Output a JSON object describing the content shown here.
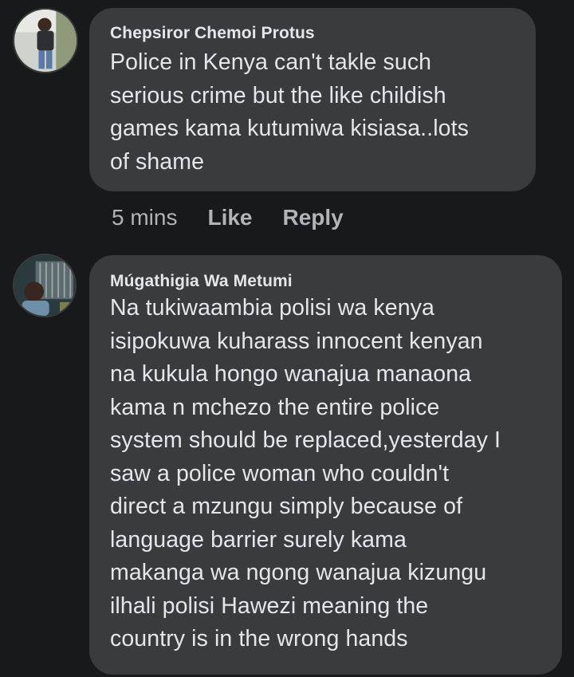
{
  "comments": [
    {
      "author": "Chepsiror Chemoi Protus",
      "text": "Police in Kenya can't takle such\nserious crime but the like childish\ngames kama kutumiwa kisiasa..lots\nof shame",
      "time": "5 mins",
      "like_label": "Like",
      "reply_label": "Reply"
    },
    {
      "author": "Múgathigia Wa Metumi",
      "text": "Na tukiwaambia polisi wa kenya\nisipokuwa kuharass innocent kenyan\nna kukula hongo wanajua manaona\nkama n mchezo the entire police\nsystem should be replaced,yesterday I\nsaw a police woman who couldn't\ndirect a mzungu simply because of\nlanguage barrier surely kama\nmakanga wa ngong wanajua kizungu\nilhali polisi Hawezi meaning the\ncountry is in the wrong hands"
    }
  ],
  "colors": {
    "background": "#18191a",
    "bubble": "#3a3b3c",
    "primary_text": "#e4e6eb",
    "secondary_text": "#b0b3b8"
  }
}
